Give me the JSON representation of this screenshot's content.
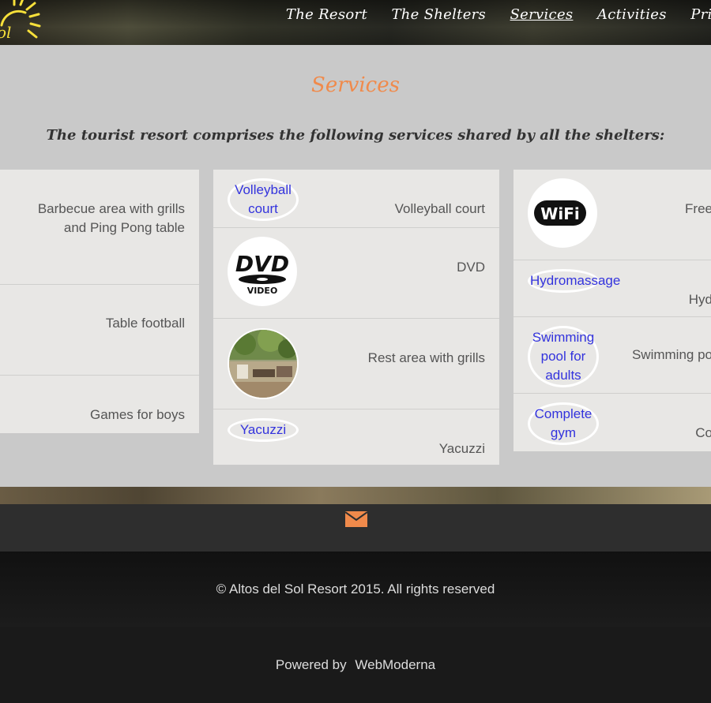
{
  "header": {
    "logo_text": "ol",
    "nav": [
      {
        "label": "The Resort"
      },
      {
        "label": "The Shelters"
      },
      {
        "label": "Services"
      },
      {
        "label": "Activities"
      },
      {
        "label": "Pric"
      }
    ]
  },
  "main": {
    "title": "Services",
    "intro": "The tourist resort comprises the following services shared by all the shelters:",
    "col_left": [
      {
        "label_line1": "Barbecue area with grills",
        "label_line2": "and Ping Pong table"
      },
      {
        "label": "Table football"
      },
      {
        "label": "Games for boys"
      }
    ],
    "col_middle": [
      {
        "badge_line1": "Volleyball",
        "badge_line2": "court",
        "label": "Volleyball court"
      },
      {
        "image_text_top": "DVD",
        "image_text_bottom": "VIDEO",
        "label": "DVD"
      },
      {
        "label": "Rest area with grills"
      },
      {
        "badge": "Yacuzzi",
        "label": "Yacuzzi"
      }
    ],
    "col_right": [
      {
        "image_text": "WiFi",
        "label": "Free"
      },
      {
        "badge": "Hydromassage",
        "label": "Hyd"
      },
      {
        "badge_line1": "Swimming",
        "badge_line2": "pool for",
        "badge_line3": "adults",
        "label": "Swimming po"
      },
      {
        "badge_line1": "Complete",
        "badge_line2": "gym",
        "label": "Co"
      }
    ]
  },
  "footer": {
    "copyright": "© Altos del Sol Resort 2015. All rights reserved",
    "powered_prefix": "Powered by",
    "powered_link": "WebModerna"
  },
  "colors": {
    "accent": "#f08a4b",
    "link": "#3333dd",
    "panel": "#c9c9c9",
    "card": "#e8e7e5"
  }
}
